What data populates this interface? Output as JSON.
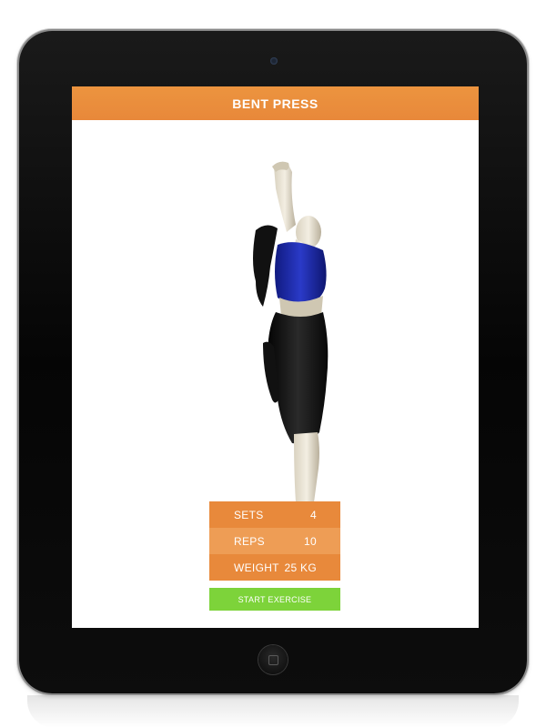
{
  "header": {
    "title": "BENT PRESS"
  },
  "stats": [
    {
      "label": "SETS",
      "value": "4"
    },
    {
      "label": "REPS",
      "value": "10"
    },
    {
      "label": "WEIGHT",
      "value": "25 KG"
    }
  ],
  "actions": {
    "start_label": "START EXERCISE"
  },
  "colors": {
    "accent_orange": "#e8883a",
    "accent_orange_light": "#ee9d55",
    "start_green": "#7dd33a",
    "device_bezel": "#0a0a0a"
  },
  "icons": {
    "camera": "front-camera-icon",
    "home": "home-button-icon"
  }
}
